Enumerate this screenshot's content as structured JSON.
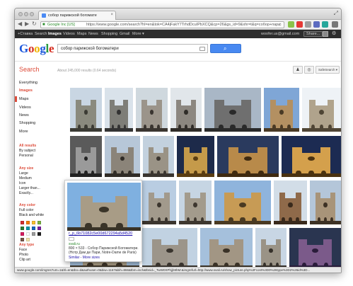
{
  "browser": {
    "tab_title": "собор парижской богомате",
    "close": "×",
    "ev_label": "Google Inc [US]",
    "url": "https://www.google.com/search?hl=en&tok=CA4jFakY7TrhdDcuIPbXCQ&cp=26&gs_id=9&xhr=t&q=собор+парижской...",
    "back": "◀",
    "forward": "▶",
    "reload": "↻",
    "star": "☆",
    "resize": "⤢"
  },
  "gbar": {
    "items": [
      "+Ставка",
      "Search",
      "Images",
      "Videos",
      "Maps",
      "News",
      "Shopping",
      "Gmail",
      "More ▾"
    ],
    "user": "woofer.us@gmail.com",
    "share": "Share..."
  },
  "search": {
    "logo": [
      "G",
      "o",
      "o",
      "g",
      "l",
      "e"
    ],
    "query": "собор парижской богоматери",
    "label": "Search",
    "stats": "About 245,000 results (0.64 seconds)",
    "safe": "SafeSearch ▾"
  },
  "sidebar": {
    "types": [
      "Everything",
      "Images",
      "Maps",
      "Videos",
      "News",
      "Shopping",
      "More"
    ],
    "results_head": "All results",
    "results_items": [
      "By subject",
      "Personal"
    ],
    "size_head": "Any size",
    "size_items": [
      "Large",
      "Medium",
      "Icon",
      "Larger than...",
      "Exactly..."
    ],
    "color_head": "Any color",
    "color_items": [
      "Full color",
      "Black and white"
    ],
    "type_head": "Any type",
    "type_items": [
      "Face",
      "Photo",
      "Clip art"
    ]
  },
  "swatches": [
    "#d32f2f",
    "#f57c00",
    "#fbc02d",
    "#7cb342",
    "#2e7d32",
    "#0097a7",
    "#1565c0",
    "#7b1fa2",
    "#d81b60",
    "#ffffff",
    "#9e9e9e",
    "#212121",
    "#795548",
    "#f3e5ab"
  ],
  "hover_card": {
    "filename": "r_p_6b71082c5e00d672294a5d4520",
    "site": "svali.ru",
    "description": "800 × 533 - Собор Парижской Богоматери. (Нотр Дам де Пари, Notre-Dame de Paris)",
    "more": "Similar - More sizes"
  },
  "status_url": "www.google.com/imgres?um=1&hl=en&tbo=d&authuser=0&biw=1167&bih=866&tbm=isch&tbnid=_TwW0XPhjjb9hM:&imgrefurl=http://www.svali.ru/show_picture.php%3Fcont%3D0%26type%3D2%26id%3D..."
}
